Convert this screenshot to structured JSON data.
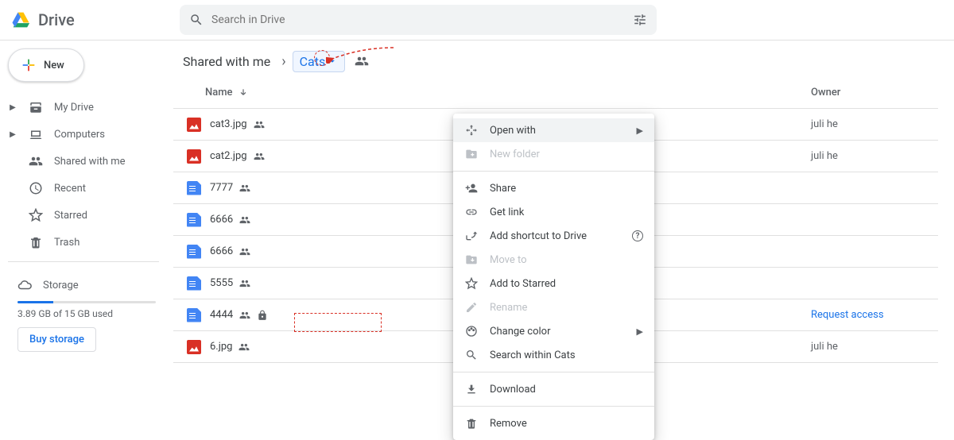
{
  "header": {
    "app_name": "Drive",
    "search_placeholder": "Search in Drive"
  },
  "sidebar": {
    "new_label": "New",
    "items": [
      {
        "label": "My Drive",
        "icon": "drive"
      },
      {
        "label": "Computers",
        "icon": "laptop"
      },
      {
        "label": "Shared with me",
        "icon": "people"
      },
      {
        "label": "Recent",
        "icon": "clock"
      },
      {
        "label": "Starred",
        "icon": "star"
      },
      {
        "label": "Trash",
        "icon": "trash"
      }
    ],
    "storage": {
      "label": "Storage",
      "used_label": "3.89 GB of 15 GB used",
      "buy_label": "Buy storage",
      "percent": 26
    }
  },
  "breadcrumb": {
    "parent": "Shared with me",
    "current": "Cats"
  },
  "table": {
    "col_name": "Name",
    "col_owner": "Owner",
    "rows": [
      {
        "name": "cat3.jpg",
        "type": "image",
        "shared": true,
        "locked": false,
        "owner": "juli he",
        "owner_link": false
      },
      {
        "name": "cat2.jpg",
        "type": "image",
        "shared": true,
        "locked": false,
        "owner": "juli he",
        "owner_link": false
      },
      {
        "name": "7777",
        "type": "docs",
        "shared": true,
        "locked": false,
        "owner": "",
        "owner_link": false
      },
      {
        "name": "6666",
        "type": "docs",
        "shared": true,
        "locked": false,
        "owner": "",
        "owner_link": false
      },
      {
        "name": "6666",
        "type": "docs",
        "shared": true,
        "locked": false,
        "owner": "",
        "owner_link": false
      },
      {
        "name": "5555",
        "type": "docs",
        "shared": true,
        "locked": false,
        "owner": "",
        "owner_link": false
      },
      {
        "name": "4444",
        "type": "docs",
        "shared": true,
        "locked": true,
        "owner": "Request access",
        "owner_link": true
      },
      {
        "name": "6.jpg",
        "type": "image",
        "shared": true,
        "locked": false,
        "owner": "juli he",
        "owner_link": false
      }
    ]
  },
  "ctx": {
    "open_with": "Open with",
    "new_folder": "New folder",
    "share": "Share",
    "get_link": "Get link",
    "add_shortcut": "Add shortcut to Drive",
    "move_to": "Move to",
    "add_starred": "Add to Starred",
    "rename": "Rename",
    "change_color": "Change color",
    "search_within": "Search within Cats",
    "download": "Download",
    "remove": "Remove"
  }
}
